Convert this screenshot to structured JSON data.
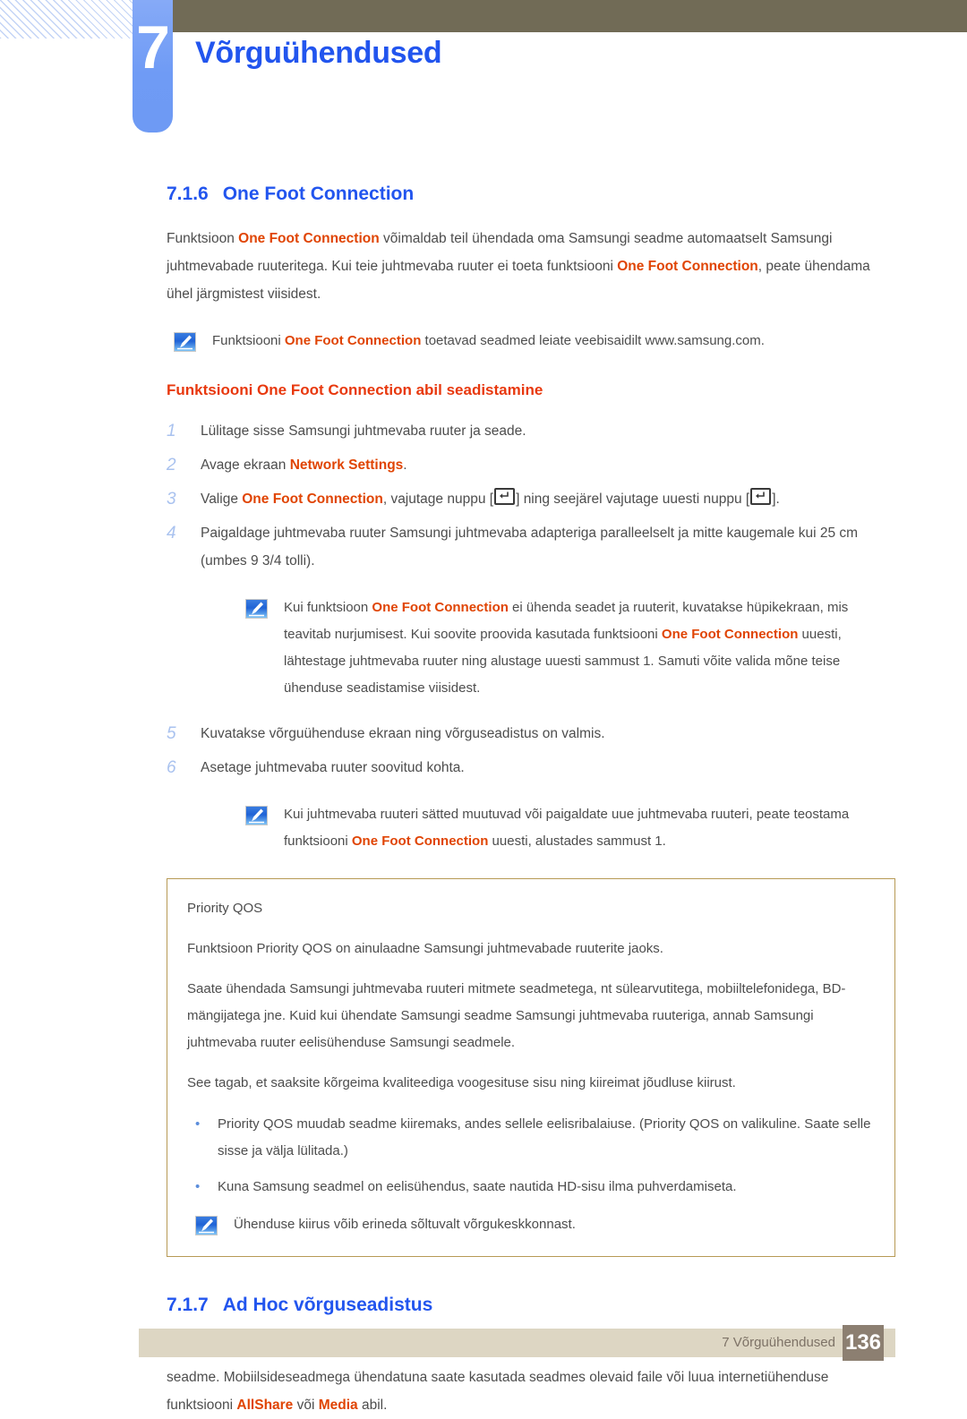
{
  "header": {
    "chapter_number": "7",
    "chapter_title": "Võrguühendused"
  },
  "sections": {
    "s716": {
      "number": "7.1.6",
      "title": "One Foot Connection",
      "intro": {
        "p1": "Funktsioon ",
        "hl1": "One Foot Connection",
        "p2": " võimaldab teil ühendada oma Samsungi seadme automaatselt Samsungi juhtmevabade ruuteritega. Kui teie juhtmevaba ruuter ei toeta funktsiooni ",
        "hl2": "One Foot Connection",
        "p3": ", peate ühendama ühel järgmistest viisidest."
      },
      "note1": {
        "t1": "Funktsiooni ",
        "hl1": "One Foot Connection",
        "t2": " toetavad seadmed leiate veebisaidilt www.samsung.com."
      },
      "subheading": "Funktsiooni One Foot Connection abil seadistamine",
      "steps": [
        {
          "num": "1",
          "t1": "Lülitage sisse Samsungi juhtmevaba ruuter ja seade."
        },
        {
          "num": "2",
          "t1": "Avage ekraan ",
          "hl1": "Network Settings",
          "t2": "."
        },
        {
          "num": "3",
          "t1": "Valige ",
          "hl1": "One Foot Connection",
          "t2": ", vajutage nuppu [",
          "key1": "enter-key-icon",
          "t3": "] ning seejärel vajutage uuesti nuppu [",
          "key2": "enter-key-icon",
          "t4": "]."
        },
        {
          "num": "4",
          "t1": "Paigaldage juhtmevaba ruuter Samsungi juhtmevaba adapteriga paralleelselt ja mitte kaugemale kui 25 cm (umbes 9 3/4 tolli)."
        }
      ],
      "note2": {
        "t1": "Kui funktsioon ",
        "hl1": "One Foot Connection",
        "t2": " ei ühenda seadet ja ruuterit, kuvatakse hüpikekraan, mis teavitab nurjumisest. Kui soovite proovida kasutada funktsiooni ",
        "hl2": "One Foot Connection",
        "t3": " uuesti, lähtestage juhtmevaba ruuter ning alustage uuesti sammust 1. Samuti võite valida mõne teise ühenduse seadistamise viisidest."
      },
      "steps2": [
        {
          "num": "5",
          "t1": "Kuvatakse võrguühenduse ekraan ning võrguseadistus on valmis."
        },
        {
          "num": "6",
          "t1": "Asetage juhtmevaba ruuter soovitud kohta."
        }
      ],
      "note3": {
        "t1": "Kui juhtmevaba ruuteri sätted muutuvad või paigaldate uue juhtmevaba ruuteri, peate teostama funktsiooni ",
        "hl1": "One Foot Connection",
        "t2": " uuesti, alustades sammust 1."
      },
      "qos": {
        "title": "Priority QOS",
        "p1": "Funktsioon Priority QOS on ainulaadne Samsungi juhtmevabade ruuterite jaoks.",
        "p2": "Saate ühendada Samsungi juhtmevaba ruuteri mitmete seadmetega, nt sülearvutitega, mobiiltelefonidega, BD-mängijatega jne. Kuid kui ühendate Samsungi seadme Samsungi juhtmevaba ruuteriga, annab Samsungi juhtmevaba ruuter eelisühenduse Samsungi seadmele.",
        "p3": "See tagab, et saaksite kõrgeima kvaliteediga voogesituse sisu ning kiireimat jõudluse kiirust.",
        "bullets": [
          "Priority QOS muudab seadme kiiremaks, andes sellele eelisribalaiuse. (Priority QOS on valikuline. Saate selle sisse ja välja lülitada.)",
          "Kuna Samsung seadmel on eelisühendus, saate nautida HD-sisu ilma puhverdamiseta."
        ],
        "bullet_marker": "•",
        "note": "Ühenduse kiirus võib erineda sõltuvalt võrgukeskkonnast."
      }
    },
    "s717": {
      "number": "7.1.7",
      "title": "Ad Hoc võrguseadistus",
      "p1": "Saate ühendada mobiilsideseadme, mis toetab Ad-hoc ühendust ilma juhtmevaba ruuteri või pääsupunktita läbi seadme. Mobiilsideseadmega ühendatuna saate kasutada seadmes olevaid faile või luua internetiühenduse funktsiooni ",
      "hl1": "AllShare",
      "p2": " või ",
      "hl2": "Media",
      "p3": " abil."
    }
  },
  "footer": {
    "label": "7 Võrguühendused",
    "page": "136"
  },
  "icons": {
    "note": "note-pencil-icon",
    "enter_key": "enter-key-icon"
  },
  "colors": {
    "heading_blue": "#2255ee",
    "highlight_orange": "#e04403",
    "highlight_red": "#e8380d",
    "body_gray": "#4d4d4d",
    "olive_bar": "#716b56",
    "tab_blue": "#6f9bf5",
    "footer_bar": "#ddd6c3",
    "footer_page_box": "#8c7f71",
    "qos_border": "#b79a55",
    "step_number": "#a9c2ef",
    "bullet_blue": "#5b8ddb"
  }
}
